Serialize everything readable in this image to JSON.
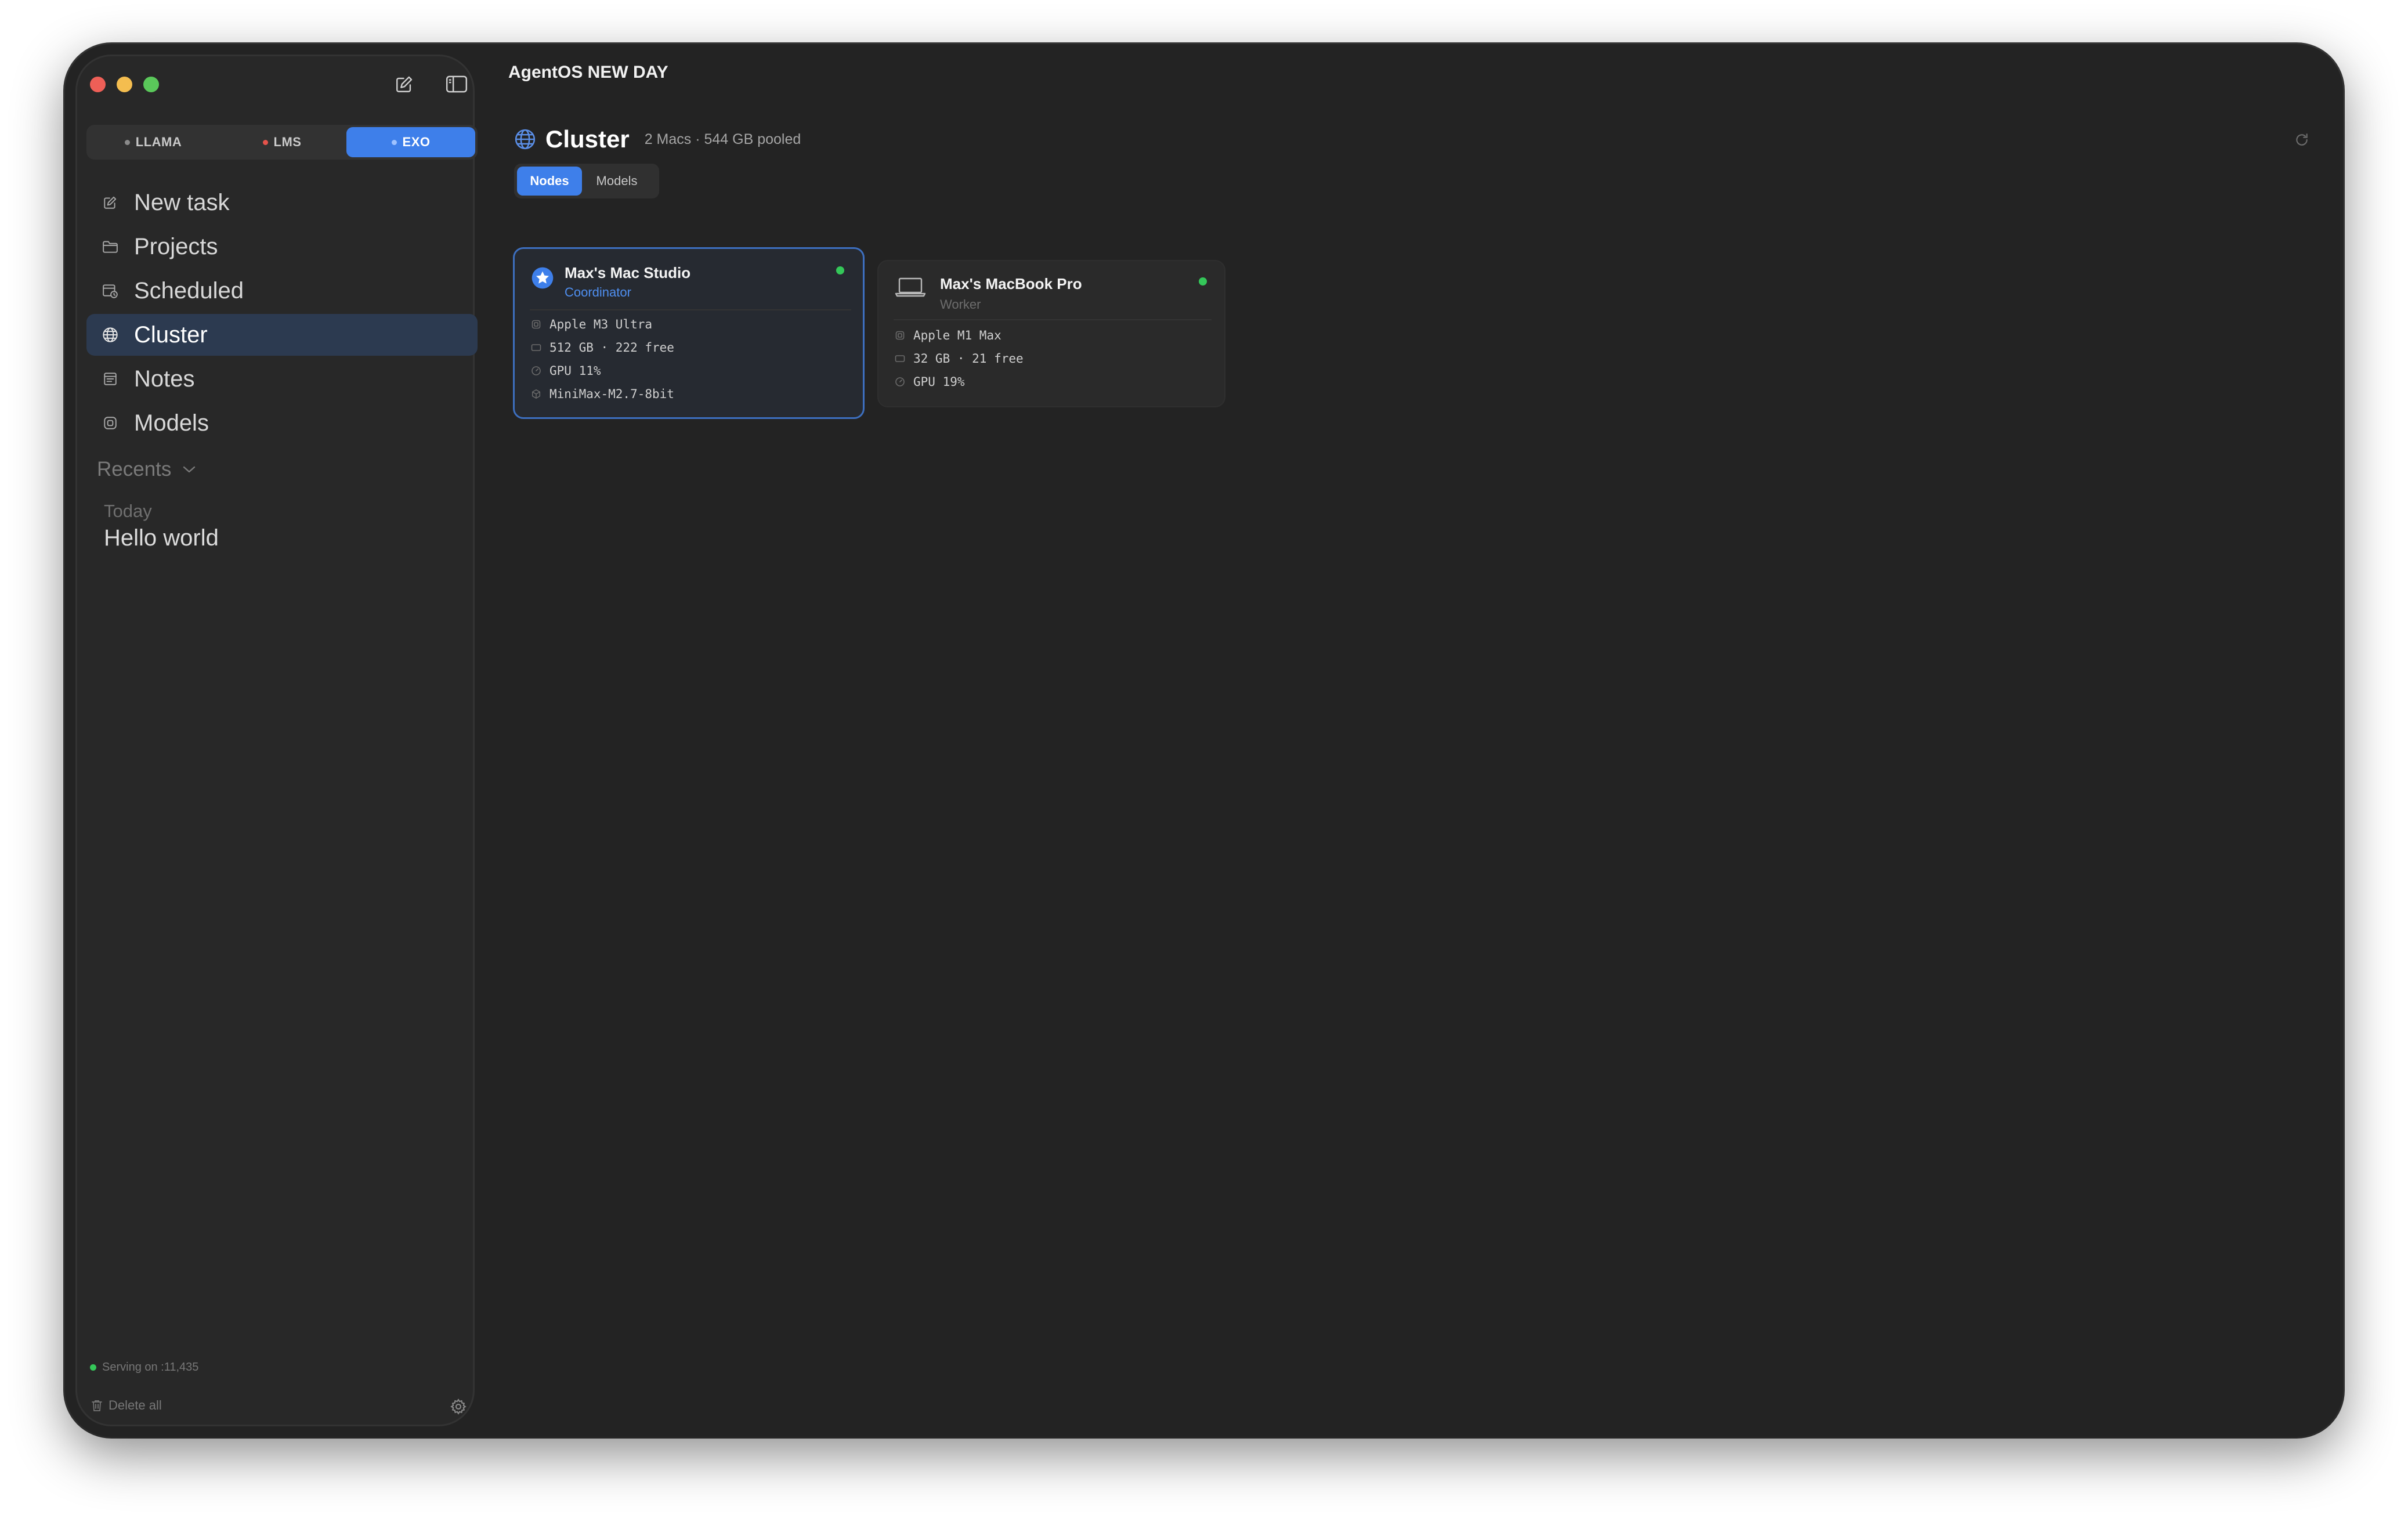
{
  "app": {
    "title": "AgentOS NEW DAY"
  },
  "colors": {
    "accent": "#3e7fea",
    "online": "#34c759",
    "lms_status": "#e5534b",
    "llama_status": "#8a8a8a",
    "exo_status": "#9ec2ff"
  },
  "sidebar": {
    "backends": [
      {
        "label": "LLAMA",
        "status_color": "#8a8a8a",
        "active": false
      },
      {
        "label": "LMS",
        "status_color": "#e5534b",
        "active": false
      },
      {
        "label": "EXO",
        "status_color": "#9ec2ff",
        "active": true
      }
    ],
    "nav": [
      {
        "label": "New task",
        "icon": "compose-icon",
        "active": false
      },
      {
        "label": "Projects",
        "icon": "folder-icon",
        "active": false
      },
      {
        "label": "Scheduled",
        "icon": "calendar-clock-icon",
        "active": false
      },
      {
        "label": "Cluster",
        "icon": "globe-icon",
        "active": true
      },
      {
        "label": "Notes",
        "icon": "notes-icon",
        "active": false
      },
      {
        "label": "Models",
        "icon": "cube-icon",
        "active": false
      }
    ],
    "recents_label": "Recents",
    "recents_group": "Today",
    "recents": [
      {
        "label": "Hello world"
      }
    ],
    "serving_text": "Serving on :11,435",
    "delete_all_label": "Delete all"
  },
  "main": {
    "title": "Cluster",
    "subtitle": "2 Macs · 544 GB pooled",
    "tabs": [
      {
        "label": "Nodes",
        "active": true
      },
      {
        "label": "Models",
        "active": false
      }
    ],
    "nodes": [
      {
        "name": "Max's Mac Studio",
        "role": "Coordinator",
        "online": true,
        "chip": "Apple M3 Ultra",
        "memory": "512 GB · 222 free",
        "gpu": "GPU 11%",
        "model": "MiniMax-M2.7-8bit"
      },
      {
        "name": "Max's MacBook Pro",
        "role": "Worker",
        "online": true,
        "chip": "Apple M1 Max",
        "memory": "32 GB · 21 free",
        "gpu": "GPU 19%"
      }
    ]
  }
}
